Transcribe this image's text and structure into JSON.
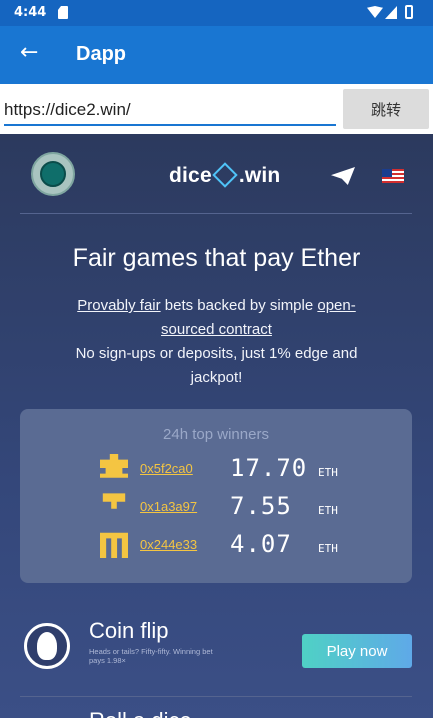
{
  "status_bar": {
    "time": "4:44"
  },
  "app_bar": {
    "title": "Dapp"
  },
  "url_bar": {
    "url": "https://dice2.win/",
    "go_label": "跳转"
  },
  "site": {
    "brand_left": "dice",
    "brand_right": ".win",
    "headline": "Fair games that pay Ether",
    "desc_link1": "Provably fair",
    "desc_text1": " bets backed by simple ",
    "desc_link2": "open-sourced contract",
    "desc_text2": "No sign-ups or deposits, just 1% edge and jackpot!",
    "winners": {
      "title": "24h top winners",
      "rows": [
        {
          "address": "0x5f2ca0",
          "amount": "17.70",
          "unit": "ETH",
          "icon": "invader-icon"
        },
        {
          "address": "0x1a3a97",
          "amount": "7.55",
          "unit": "ETH",
          "icon": "t-pixel-icon"
        },
        {
          "address": "0x244e33",
          "amount": "4.07",
          "unit": "ETH",
          "icon": "m-pixel-icon"
        }
      ]
    },
    "games": [
      {
        "title": "Coin flip",
        "subtitle": "Heads or tails? Fifty-fifty. Winning bet pays 1.98×",
        "play_label": "Play now"
      },
      {
        "title": "Roll a dice"
      }
    ]
  },
  "colors": {
    "appbar": "#1976d2",
    "statusbar": "#1565c0",
    "accent_gold": "#f4c542",
    "page_bg": "#2e3e6e"
  }
}
